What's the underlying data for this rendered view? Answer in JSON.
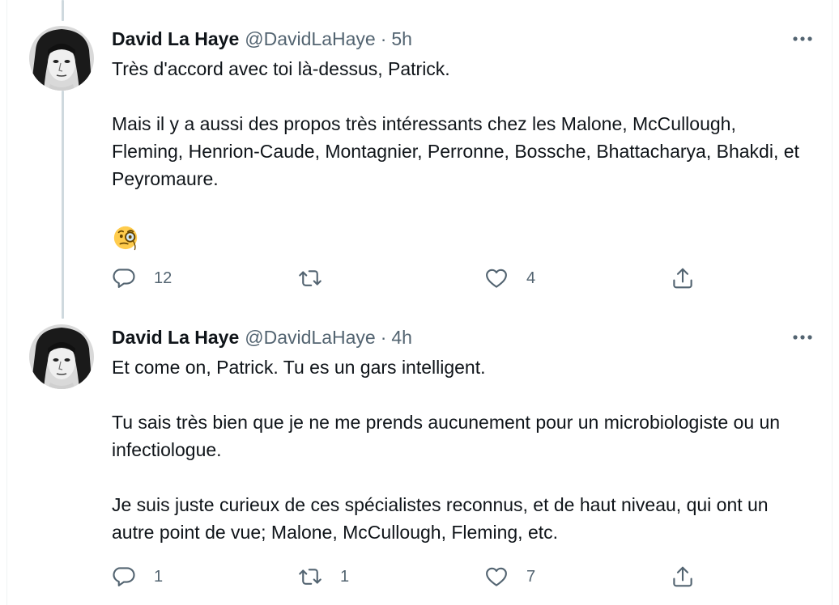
{
  "tweets": [
    {
      "display_name": "David La Haye",
      "handle": "@DavidLaHaye",
      "separator": "·",
      "time": "5h",
      "paragraphs": [
        "Très d'accord avec toi là-dessus, Patrick.",
        "Mais il y a aussi des propos très intéressants chez les Malone, McCullough, Fleming, Henrion-Caude, Montagnier, Perronne, Bossche, Bhattacharya, Bhakdi, et Peyromaure."
      ],
      "emoji": "monocle-face",
      "reply_count": "12",
      "retweet_count": "",
      "like_count": "4"
    },
    {
      "display_name": "David La Haye",
      "handle": "@DavidLaHaye",
      "separator": "·",
      "time": "4h",
      "paragraphs": [
        "Et come on, Patrick. Tu es un gars intelligent.",
        "Tu sais très bien que je ne me prends aucunement pour un microbiologiste ou un infectiologue.",
        "Je suis juste curieux de ces spécialistes reconnus, et de haut niveau, qui ont un autre point de vue; Malone, McCullough, Fleming, etc."
      ],
      "reply_count": "1",
      "retweet_count": "1",
      "like_count": "7"
    }
  ],
  "icons": {
    "more": "more-horizontal-icon",
    "reply": "reply-icon",
    "retweet": "retweet-icon",
    "like": "heart-icon",
    "share": "share-icon"
  },
  "colors": {
    "text": "#0f1419",
    "secondary": "#536471",
    "thread_line": "#cfd9de",
    "border": "#eff3f4"
  }
}
